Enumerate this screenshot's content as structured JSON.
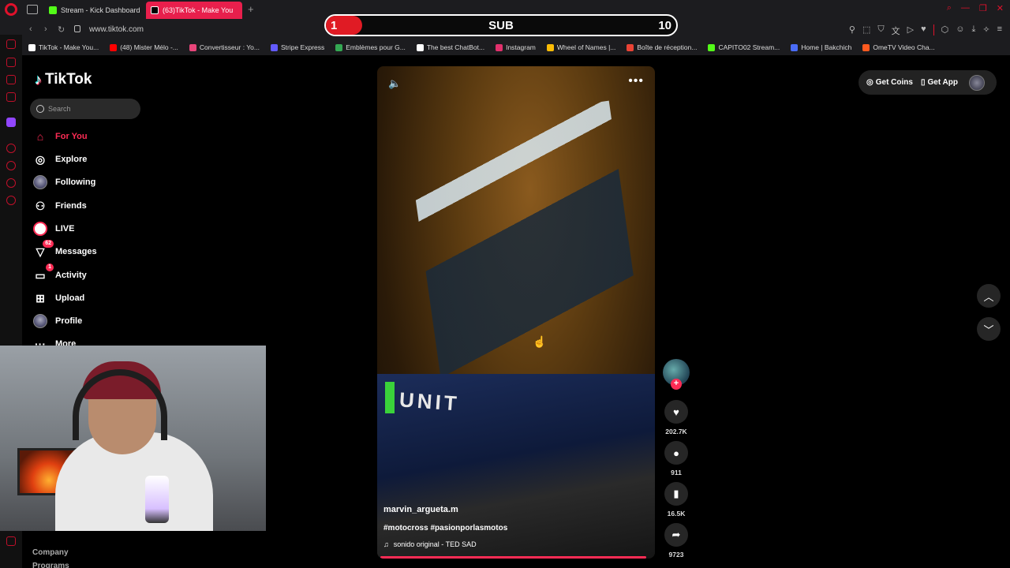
{
  "browser": {
    "tabs": [
      {
        "label": "Stream - Kick Dashboard",
        "color": "#53fc18"
      },
      {
        "label": "(63)TikTok - Make You",
        "color": "#ffffff"
      }
    ],
    "url": "www.tiktok.com",
    "bookmarks": [
      {
        "label": "TikTok - Make You...",
        "color": "#ffffff"
      },
      {
        "label": "(48) Mister Mélo -...",
        "color": "#ff0000"
      },
      {
        "label": "Convertisseur : Yo...",
        "color": "#e8457a"
      },
      {
        "label": "Stripe Express",
        "color": "#635bff"
      },
      {
        "label": "Emblèmes pour G...",
        "color": "#34a853"
      },
      {
        "label": "The best ChatBot...",
        "color": "#ffffff"
      },
      {
        "label": "Instagram",
        "color": "#e1306c"
      },
      {
        "label": "Wheel of Names |...",
        "color": "#fbbc05"
      },
      {
        "label": "Boîte de réception...",
        "color": "#ea4335"
      },
      {
        "label": "CAPITO02 Stream...",
        "color": "#53fc18"
      },
      {
        "label": "Home | Bakchich",
        "color": "#4a6cf7"
      },
      {
        "label": "OmeTV Video Cha...",
        "color": "#ff5a1f"
      }
    ]
  },
  "subgoal": {
    "current": "1",
    "label": "SUB",
    "goal": "10",
    "fill_fraction": 0.1
  },
  "tiktok": {
    "logo_text": "TikTok",
    "search_placeholder": "Search",
    "nav": [
      {
        "label": "For You",
        "icon": "home-icon"
      },
      {
        "label": "Explore",
        "icon": "compass-icon"
      },
      {
        "label": "Following",
        "icon": "avatar-icon"
      },
      {
        "label": "Friends",
        "icon": "friends-icon"
      },
      {
        "label": "LIVE",
        "icon": "live-icon"
      },
      {
        "label": "Messages",
        "icon": "messages-icon",
        "badge": "62"
      },
      {
        "label": "Activity",
        "icon": "activity-icon",
        "badge": "1"
      },
      {
        "label": "Upload",
        "icon": "upload-icon"
      },
      {
        "label": "Profile",
        "icon": "avatar-icon"
      },
      {
        "label": "More",
        "icon": "more-icon"
      }
    ],
    "footer": {
      "company": "Company",
      "programs": "Programs"
    },
    "get_coins": "Get Coins",
    "get_app": "Get App",
    "video": {
      "author": "marvin_argueta.m",
      "tags": "#motocross #pasionporlasmotos",
      "sound": "sonido original - TED SAD",
      "progress_fraction": 0.98,
      "likes": "202.7K",
      "comments": "911",
      "saves": "16.5K",
      "shares": "9723"
    }
  }
}
